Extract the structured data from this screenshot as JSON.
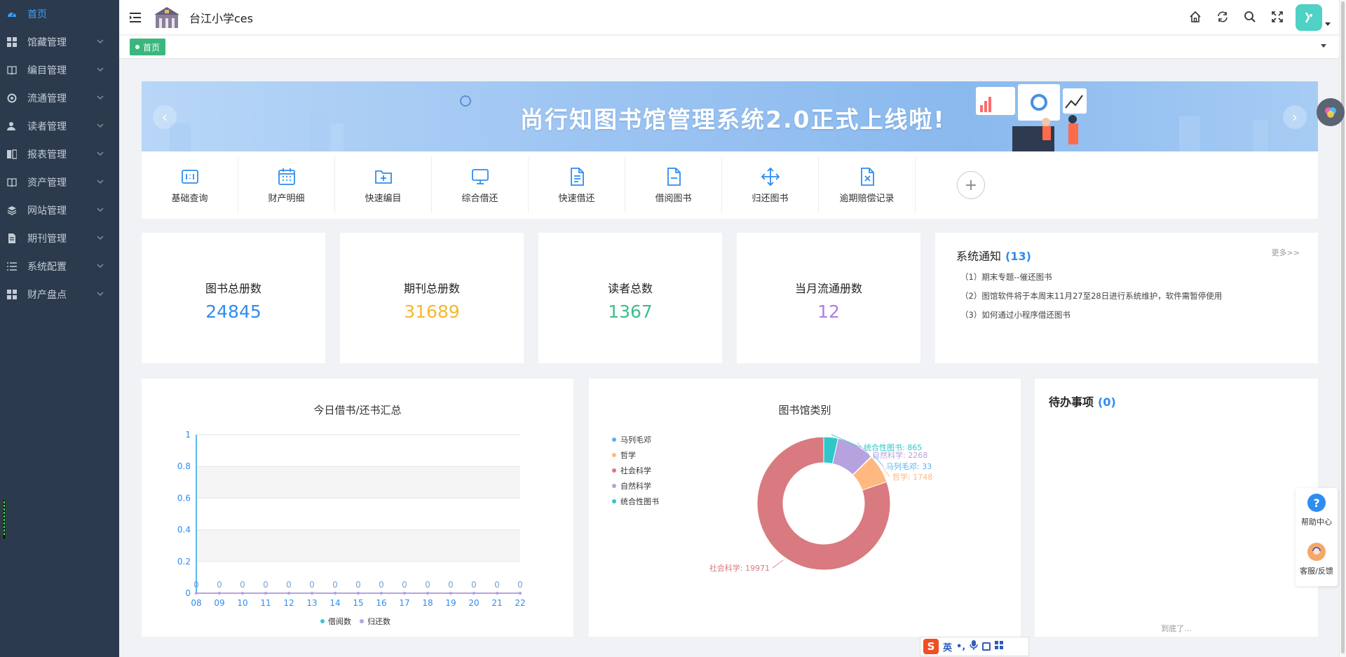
{
  "sidebar": {
    "items": [
      {
        "label": "首页",
        "icon": "dashboard-icon",
        "active": true
      },
      {
        "label": "馆藏管理",
        "icon": "grid-icon"
      },
      {
        "label": "编目管理",
        "icon": "book-icon"
      },
      {
        "label": "流通管理",
        "icon": "cycle-icon"
      },
      {
        "label": "读者管理",
        "icon": "user-icon"
      },
      {
        "label": "报表管理",
        "icon": "report-icon"
      },
      {
        "label": "资产管理",
        "icon": "book-icon"
      },
      {
        "label": "网站管理",
        "icon": "layers-icon"
      },
      {
        "label": "期刊管理",
        "icon": "document-icon"
      },
      {
        "label": "系统配置",
        "icon": "list-icon"
      },
      {
        "label": "财产盘点",
        "icon": "grid-icon"
      }
    ]
  },
  "header": {
    "school_name": "台江小学ces"
  },
  "tabs": [
    {
      "label": "首页",
      "active": true
    }
  ],
  "banner": {
    "title": "尚行知图书馆管理系统2.0正式上线啦!",
    "prev": "‹",
    "next": "›"
  },
  "quick_menu": [
    {
      "label": "基础查询",
      "icon": "query-icon"
    },
    {
      "label": "财产明细",
      "icon": "calendar-icon"
    },
    {
      "label": "快速编目",
      "icon": "folder-add-icon"
    },
    {
      "label": "综合借还",
      "icon": "monitor-icon"
    },
    {
      "label": "快速借还",
      "icon": "file-text-icon"
    },
    {
      "label": "借阅图书",
      "icon": "file-minus-icon"
    },
    {
      "label": "归还图书",
      "icon": "move-icon"
    },
    {
      "label": "逾期赔偿记录",
      "icon": "file-x-icon"
    }
  ],
  "stats": [
    {
      "label": "图书总册数",
      "value": "24845",
      "color": "#2f8cf0"
    },
    {
      "label": "期刊总册数",
      "value": "31689",
      "color": "#f5b82e"
    },
    {
      "label": "读者总数",
      "value": "1367",
      "color": "#3cbf88"
    },
    {
      "label": "当月流通册数",
      "value": "12",
      "color": "#b07ee0"
    }
  ],
  "notice": {
    "title": "系统通知",
    "count": "(13)",
    "more": "更多>>",
    "items": [
      "（1）期末专题--催还图书",
      "（2）图馆软件将于本周末11月27至28日进行系统维护，软件需暂停使用",
      "（3）如何通过小程序借还图书"
    ]
  },
  "todo": {
    "title": "待办事项",
    "count": "(0)",
    "end_text": "到底了..."
  },
  "help": {
    "center": "帮助中心",
    "feedback": "客服/反馈"
  },
  "ime": {
    "lang": "英"
  },
  "chart_data": [
    {
      "type": "line",
      "title": "今日借书/还书汇总",
      "x": [
        "08",
        "09",
        "10",
        "11",
        "12",
        "13",
        "14",
        "15",
        "16",
        "17",
        "18",
        "19",
        "20",
        "21",
        "22"
      ],
      "ylim": [
        0,
        1
      ],
      "yticks": [
        "0",
        "0.2",
        "0.4",
        "0.6",
        "0.8",
        "1"
      ],
      "series": [
        {
          "name": "借阅数",
          "values": [
            0,
            0,
            0,
            0,
            0,
            0,
            0,
            0,
            0,
            0,
            0,
            0,
            0,
            0,
            0
          ],
          "color": "#36c6d3"
        },
        {
          "name": "归还数",
          "values": [
            0,
            0,
            0,
            0,
            0,
            0,
            0,
            0,
            0,
            0,
            0,
            0,
            0,
            0,
            0
          ],
          "color": "#b7a3e0"
        }
      ],
      "legend": "bottom",
      "grid": true
    },
    {
      "type": "pie",
      "title": "图书馆类别",
      "legend": "top-left",
      "slices": [
        {
          "name": "马列毛邓",
          "value": 33,
          "color": "#5ab1ef"
        },
        {
          "name": "哲学",
          "value": 1748,
          "color": "#ffb980"
        },
        {
          "name": "社会科学",
          "value": 19971,
          "color": "#d87a80"
        },
        {
          "name": "自然科学",
          "value": 2268,
          "color": "#b6a2de"
        },
        {
          "name": "统合性图书",
          "value": 865,
          "color": "#2ec7c9"
        }
      ]
    }
  ]
}
